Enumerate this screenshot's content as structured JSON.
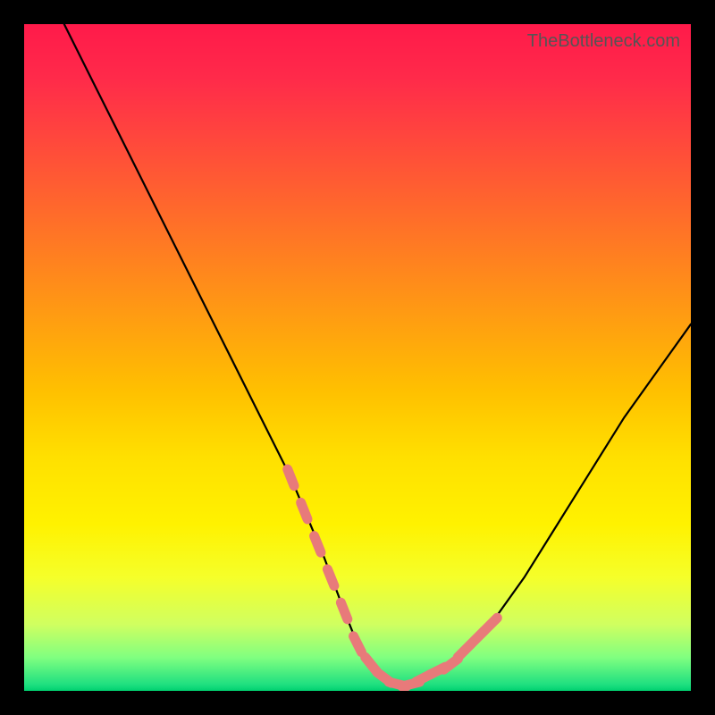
{
  "watermark": "TheBottleneck.com",
  "chart_data": {
    "type": "line",
    "title": "",
    "xlabel": "",
    "ylabel": "",
    "xlim": [
      0,
      100
    ],
    "ylim": [
      0,
      100
    ],
    "series": [
      {
        "name": "bottleneck-curve",
        "x": [
          6,
          10,
          15,
          20,
          25,
          30,
          35,
          40,
          45,
          48,
          50,
          52,
          54,
          56,
          58,
          60,
          62,
          65,
          70,
          75,
          80,
          85,
          90,
          95,
          100
        ],
        "y": [
          100,
          92,
          82,
          72,
          62,
          52,
          42,
          32,
          20,
          12,
          7,
          4,
          2,
          1,
          1,
          2,
          3,
          5,
          10,
          17,
          25,
          33,
          41,
          48,
          55
        ]
      },
      {
        "name": "highlight-dots",
        "x": [
          40,
          42,
          44,
          46,
          48,
          50,
          52,
          54,
          56,
          58,
          60,
          62,
          64,
          66,
          68,
          70
        ],
        "y": [
          32,
          27,
          22,
          17,
          12,
          7,
          4,
          2,
          1,
          1,
          2,
          3,
          4,
          6,
          8,
          10
        ]
      }
    ],
    "background_gradient": {
      "top": "#ff1a4a",
      "mid1": "#ff8020",
      "mid2": "#ffe000",
      "bottom": "#00d070"
    }
  }
}
